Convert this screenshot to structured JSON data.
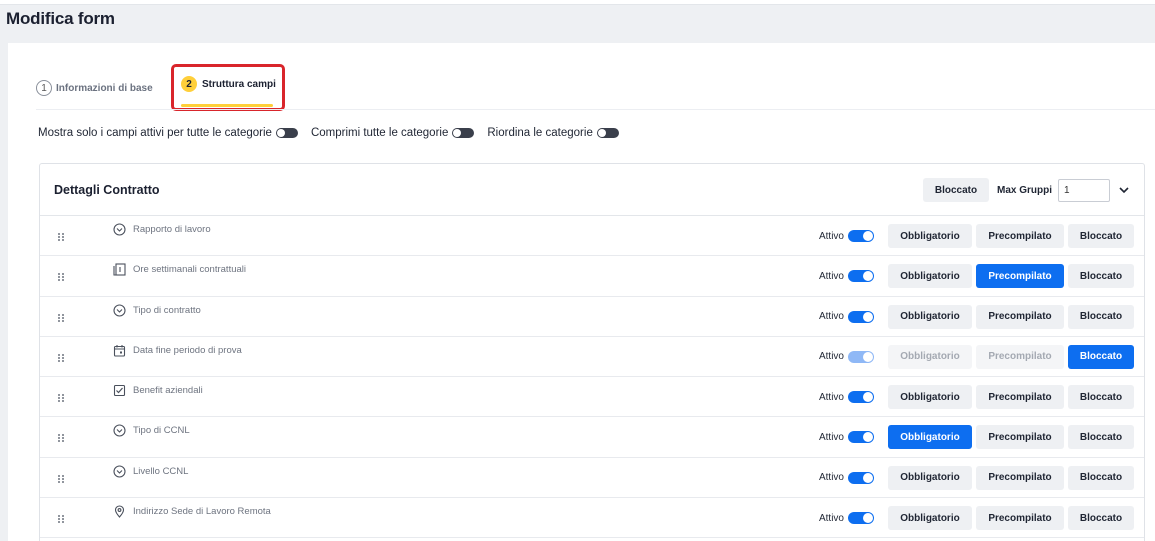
{
  "page": {
    "title": "Modifica form"
  },
  "stepper": {
    "steps": [
      {
        "number": "1",
        "label": "Informazioni di base"
      },
      {
        "number": "2",
        "label": "Struttura campi"
      }
    ]
  },
  "options": [
    {
      "label": "Mostra solo i campi attivi per tutte le categorie",
      "on": false
    },
    {
      "label": "Comprimi tutte le categorie",
      "on": false
    },
    {
      "label": "Riordina le categorie",
      "on": false
    }
  ],
  "panel": {
    "title": "Dettagli Contratto",
    "bloccato_label": "Bloccato",
    "max_gruppi_label": "Max Gruppi",
    "max_gruppi_value": "1"
  },
  "row_labels": {
    "attivo": "Attivo",
    "obbligatorio": "Obbligatorio",
    "precompilato": "Precompilato",
    "bloccato": "Bloccato"
  },
  "fields": [
    {
      "label": "Rapporto di lavoro",
      "icon": "dropdown-circle-icon",
      "active": true,
      "selected": ""
    },
    {
      "label": "Ore settimanali contrattuali",
      "icon": "number-box-icon",
      "active": true,
      "selected": "precompilato"
    },
    {
      "label": "Tipo di contratto",
      "icon": "dropdown-circle-icon",
      "active": true,
      "selected": ""
    },
    {
      "label": "Data fine periodo di prova",
      "icon": "calendar-icon",
      "active": true,
      "selected": "bloccato",
      "disabled": true
    },
    {
      "label": "Benefit aziendali",
      "icon": "checkbox-icon",
      "active": true,
      "selected": ""
    },
    {
      "label": "Tipo di CCNL",
      "icon": "dropdown-circle-icon",
      "active": true,
      "selected": "obbligatorio"
    },
    {
      "label": "Livello CCNL",
      "icon": "dropdown-circle-icon",
      "active": true,
      "selected": ""
    },
    {
      "label": "Indirizzo Sede di Lavoro Remota",
      "icon": "location-pin-icon",
      "active": true,
      "selected": ""
    }
  ],
  "colors": {
    "accent": "#0d6ef0",
    "highlight": "#ffcf3a",
    "outline": "#d9252b"
  }
}
